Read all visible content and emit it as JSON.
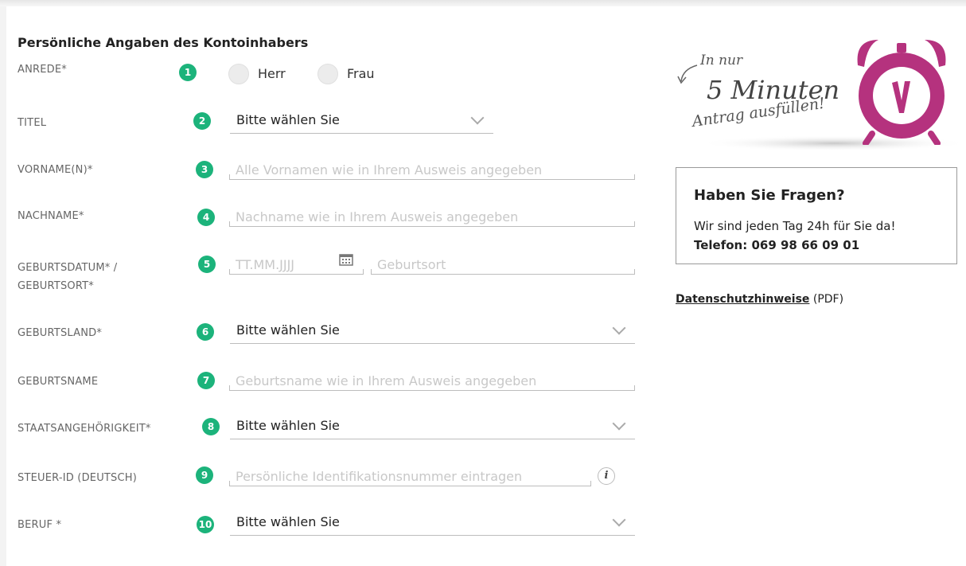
{
  "form": {
    "heading": "Persönliche Angaben des Kontoinhabers",
    "fields": {
      "anrede": {
        "label": "ANREDE*",
        "badge": "1",
        "options": [
          "Herr",
          "Frau"
        ]
      },
      "titel": {
        "label": "TITEL",
        "badge": "2",
        "value": "Bitte wählen Sie"
      },
      "vorname": {
        "label": "VORNAME(N)*",
        "badge": "3",
        "placeholder": "Alle Vornamen wie in Ihrem Ausweis angegeben"
      },
      "nachname": {
        "label": "NACHNAME*",
        "badge": "4",
        "placeholder": "Nachname wie in Ihrem Ausweis angegeben"
      },
      "geburt": {
        "label_line1": "GEBURTSDATUM* /",
        "label_line2": "GEBURTSORT*",
        "badge": "5",
        "date_placeholder": "TT.MM.JJJJ",
        "place_placeholder": "Geburtsort"
      },
      "geburtsland": {
        "label": "GEBURTSLAND*",
        "badge": "6",
        "value": "Bitte wählen Sie"
      },
      "geburtsname": {
        "label": "GEBURTSNAME",
        "badge": "7",
        "placeholder": "Geburtsname wie in Ihrem Ausweis angegeben"
      },
      "staatsangehoerigkeit": {
        "label": "STAATSANGEHÖRIGKEIT*",
        "badge": "8",
        "value": "Bitte wählen Sie"
      },
      "steuer_id": {
        "label": "STEUER-ID (DEUTSCH)",
        "badge": "9",
        "placeholder": "Persönliche Identifikationsnummer eintragen",
        "info_icon": "i"
      },
      "beruf": {
        "label": "BERUF *",
        "badge": "10",
        "value": "Bitte wählen Sie"
      }
    }
  },
  "promo": {
    "line1": "In nur",
    "line2": "5 Minuten",
    "line3": "Antrag ausfüllen!",
    "icon": "alarm-clock-icon"
  },
  "faq": {
    "title": "Haben Sie Fragen?",
    "text": "Wir sind jeden Tag 24h für Sie da!",
    "phone": "Telefon: 069 98 66 09 01"
  },
  "privacy": {
    "link_label": "Datenschutzhinweise",
    "suffix": "(PDF)"
  },
  "colors": {
    "badge_green": "#1cb37b",
    "clock_magenta": "#b5327e"
  }
}
